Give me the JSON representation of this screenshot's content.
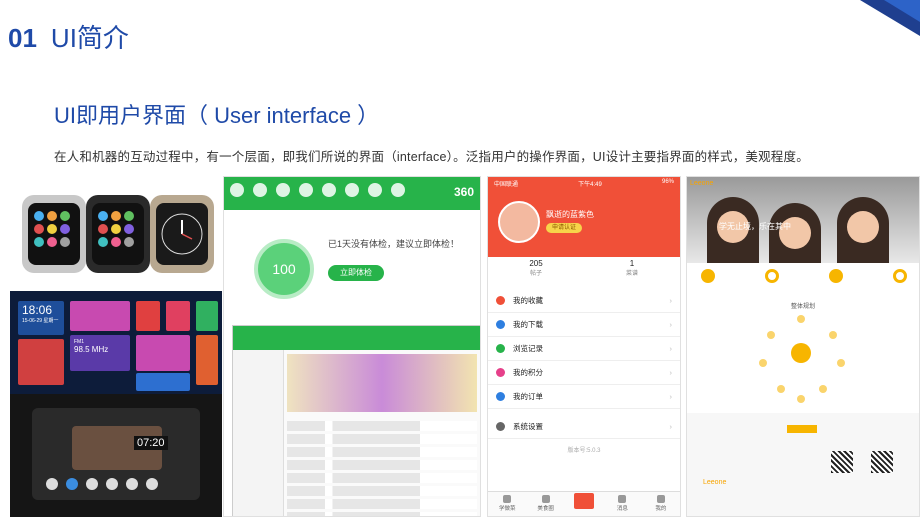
{
  "slide": {
    "number": "01",
    "title": "UI简介",
    "subtitle": "UI即用户界面（ User interface ）",
    "description": "在人和机器的互动过程中，有一个层面，即我们所说的界面（interface）。泛指用户的操作界面，UI设计主要指界面的样式，美观程度。"
  },
  "car_screen": {
    "time": "18:06",
    "date": "15-06-29  星期一",
    "fm": "FM1",
    "freq": "98.5 MHz",
    "clock": "07:20"
  },
  "app360": {
    "score": "100",
    "note": "已1天没有体检，建议立即体检！",
    "button": "立即体检",
    "logo": "360"
  },
  "phone": {
    "carrier": "中国联通",
    "time": "下午4:49",
    "battery": "96%",
    "username": "飘逝的蓝紫色",
    "badge": "申请认证",
    "stats": [
      {
        "value": "205",
        "label": "帖子"
      },
      {
        "value": "1",
        "label": "菜谱"
      }
    ],
    "menu": [
      {
        "label": "我的收藏",
        "color": "#f05038"
      },
      {
        "label": "我的下载",
        "color": "#2e7fe0"
      },
      {
        "label": "浏览记录",
        "color": "#27b34a"
      },
      {
        "label": "我的积分",
        "color": "#e6408a"
      },
      {
        "label": "我的订单",
        "color": "#2e7fe0"
      },
      {
        "label": "系统设置",
        "color": "#666666"
      }
    ],
    "version": "版本号:5.0.3",
    "tabs": [
      "学做菜",
      "美食圈",
      "",
      "消息",
      "我的"
    ]
  },
  "web": {
    "logo": "Leeone",
    "hero_text": "学无止境，乐在其中",
    "section_title": "整体规划",
    "footer_logo": "Leeone"
  },
  "colors": {
    "title_blue": "#1f4aa8",
    "green360": "#27b34a",
    "phone_red": "#f05038",
    "web_yellow": "#f7b500"
  }
}
